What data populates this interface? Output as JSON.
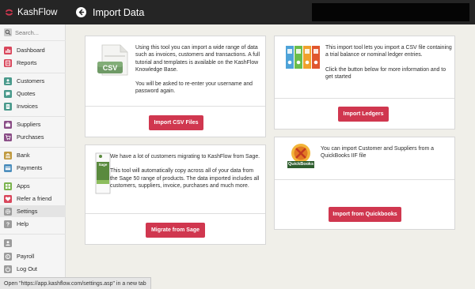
{
  "app": {
    "name": "KashFlow",
    "brand_color": "#d0374f"
  },
  "header": {
    "title": "Import Data",
    "back_icon": "arrow-left-icon"
  },
  "sidebar": {
    "search_placeholder": "Search...",
    "items": [
      {
        "label": "Dashboard",
        "icon": "dashboard-icon",
        "color": "#d9475c"
      },
      {
        "label": "Reports",
        "icon": "reports-icon",
        "color": "#d9475c"
      },
      {
        "label": "Customers",
        "icon": "customers-icon",
        "color": "#4a9a8c"
      },
      {
        "label": "Quotes",
        "icon": "quotes-icon",
        "color": "#4a9a8c"
      },
      {
        "label": "Invoices",
        "icon": "invoices-icon",
        "color": "#4a9a8c"
      },
      {
        "label": "Suppliers",
        "icon": "suppliers-icon",
        "color": "#8a4d86"
      },
      {
        "label": "Purchases",
        "icon": "purchases-icon",
        "color": "#8a4d86"
      },
      {
        "label": "Bank",
        "icon": "bank-icon",
        "color": "#c09a40"
      },
      {
        "label": "Payments",
        "icon": "payments-icon",
        "color": "#4e8fbd"
      },
      {
        "label": "Apps",
        "icon": "apps-icon",
        "color": "#7bb34e"
      },
      {
        "label": "Refer a friend",
        "icon": "heart-icon",
        "color": "#d9475c"
      },
      {
        "label": "Settings",
        "icon": "gear-icon",
        "color": "#9b9b9b"
      },
      {
        "label": "Help",
        "icon": "help-icon",
        "color": "#9b9b9b"
      },
      {
        "label": "Payroll",
        "icon": "payroll-icon",
        "color": "#9b9b9b"
      },
      {
        "label": "Log Out",
        "icon": "logout-icon",
        "color": "#9b9b9b"
      }
    ],
    "active": "Settings"
  },
  "cards": {
    "csv": {
      "image_label": "CSV",
      "text1": "Using this tool you can import a wide range of data such as invoices, customers and transactions. A full tutorial and templates is available on the KashFlow Knowledge Base.",
      "text2": "You will be asked to re-enter your username and password again.",
      "button": "Import CSV Files"
    },
    "ledgers": {
      "text1": "This import tool lets you import a CSV file containing a trial balance or nominal ledger entries.",
      "text2": "Click the button below for more information and to get started",
      "button": "Import Ledgers"
    },
    "sage": {
      "image_label": "Sage",
      "text1": "We have a lot of customers migrating to KashFlow from Sage.",
      "text2": "This tool will automatically copy across all of your data from the Sage 50 range of products. The data imported includes all customers, suppliers, invoice, purchases and much more.",
      "button": "Migrate from Sage"
    },
    "quickbooks": {
      "image_label": "QuickBooks",
      "text1": "You can import Customer and Suppliers from a QuickBooks IIF file",
      "button": "Import from Quickbooks"
    }
  },
  "status_bar": "Open \"https://app.kashflow.com/settings.asp\" in a new tab"
}
